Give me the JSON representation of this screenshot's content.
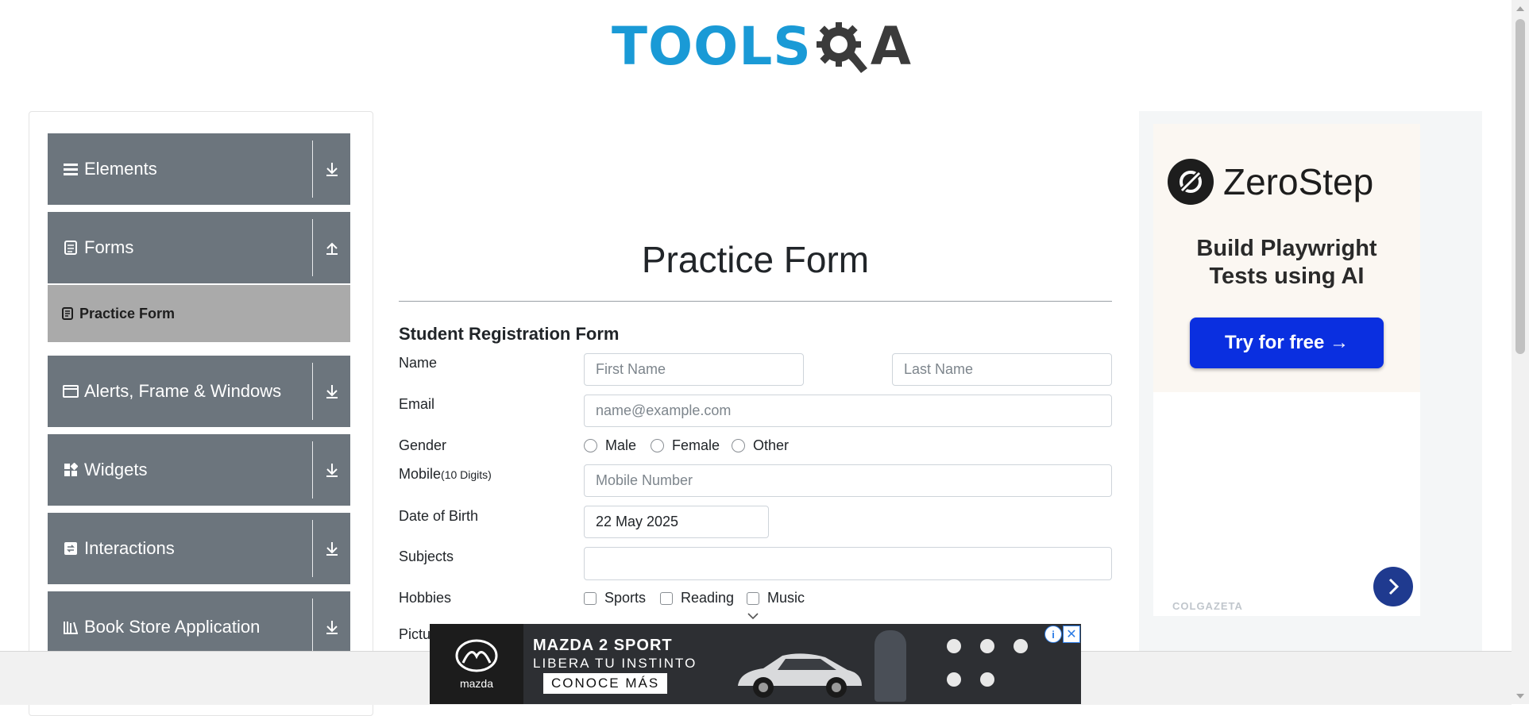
{
  "logo": {
    "prefix": "TOOLS",
    "suffix": "A"
  },
  "sidebar": {
    "groups": [
      {
        "label": "Elements",
        "icon": "menu-icon",
        "expanded": false
      },
      {
        "label": "Forms",
        "icon": "document-icon",
        "expanded": true
      },
      {
        "label": "Alerts, Frame & Windows",
        "icon": "window-icon",
        "expanded": false
      },
      {
        "label": "Widgets",
        "icon": "widgets-icon",
        "expanded": false
      },
      {
        "label": "Interactions",
        "icon": "interactions-icon",
        "expanded": false
      },
      {
        "label": "Book Store Application",
        "icon": "books-icon",
        "expanded": false
      }
    ],
    "active_item": "Practice Form"
  },
  "main": {
    "title": "Practice Form",
    "form_title": "Student Registration Form",
    "labels": {
      "name": "Name",
      "email": "Email",
      "gender": "Gender",
      "mobile": "Mobile",
      "mobile_hint": "(10 Digits)",
      "dob": "Date of Birth",
      "subjects": "Subjects",
      "hobbies": "Hobbies",
      "picture": "Pictu"
    },
    "placeholders": {
      "first_name": "First Name",
      "last_name": "Last Name",
      "email": "name@example.com",
      "mobile": "Mobile Number"
    },
    "dob_value": "22 May 2025",
    "genders": [
      "Male",
      "Female",
      "Other"
    ],
    "hobbies": [
      "Sports",
      "Reading",
      "Music"
    ]
  },
  "ad_right": {
    "brand": "ZeroStep",
    "headline_1": "Build Playwright",
    "headline_2": "Tests using AI",
    "cta": "Try for free →",
    "footer": "COLGAZETA"
  },
  "ad_banner": {
    "brand": "mazda",
    "line_1": "MAZDA 2 SPORT",
    "line_2": "LIBERA TU INSTINTO",
    "cta": "CONOCE MÁS"
  },
  "colors": {
    "sidebar": "#6c757d",
    "active_item": "#aaaaaa",
    "logo_blue": "#1a9ad6",
    "cta_blue": "#0a2fe0"
  }
}
